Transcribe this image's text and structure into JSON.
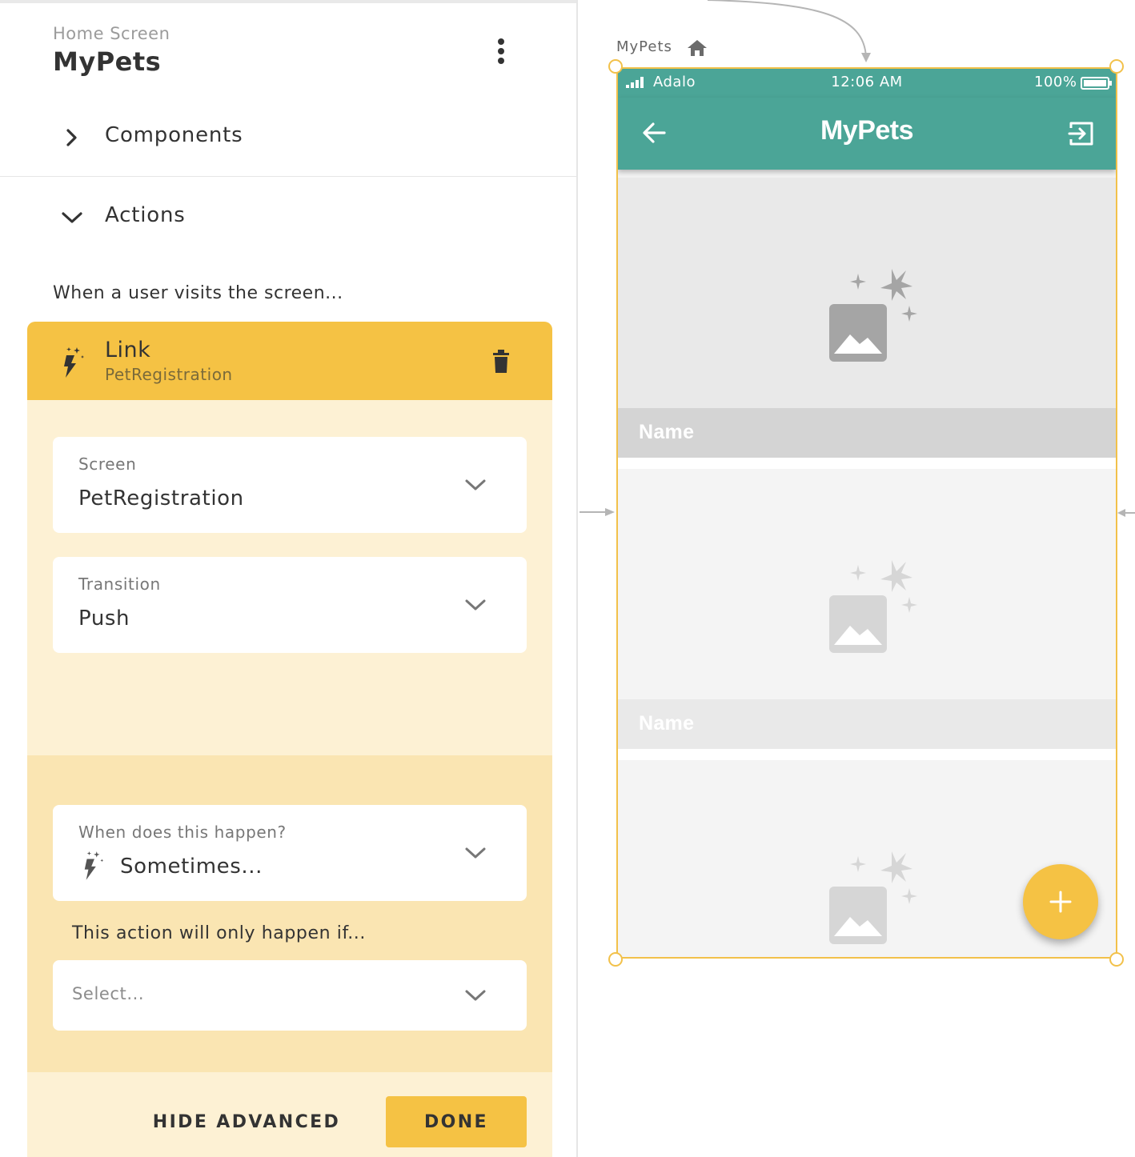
{
  "panel": {
    "screen_subtitle": "Home Screen",
    "screen_title": "MyPets",
    "sections": {
      "components": "Components",
      "actions": "Actions"
    },
    "trigger_text": "When a user visits the screen..."
  },
  "action": {
    "type": "Link",
    "target": "PetRegistration",
    "fields": {
      "screen": {
        "label": "Screen",
        "value": "PetRegistration"
      },
      "transition": {
        "label": "Transition",
        "value": "Push"
      }
    },
    "advanced": {
      "when": {
        "label": "When does this happen?",
        "value": "Sometimes..."
      },
      "condition_text": "This action will only happen if...",
      "condition_placeholder": "Select..."
    },
    "hide_advanced_label": "HIDE ADVANCED",
    "done_label": "DONE"
  },
  "canvas": {
    "screen_name": "MyPets",
    "status_bar": {
      "carrier": "Adalo",
      "time": "12:06 AM",
      "battery": "100%"
    },
    "app_title": "MyPets",
    "list_items": [
      {
        "name": "Name"
      },
      {
        "name": "Name"
      },
      {
        "name": ""
      }
    ]
  },
  "colors": {
    "accent": "#f5c244",
    "card_background": "#fdf1d4",
    "advanced_background": "#fae5b2",
    "app_bar": "#4ba597",
    "selection_border": "#f2c14a"
  },
  "icons": {
    "menu": "kebab-icon",
    "collapsed": "chevron-right-icon",
    "expanded": "chevron-down-icon",
    "action": "magic-bolt-icon",
    "delete": "trash-icon",
    "home": "home-icon",
    "back": "arrow-left-icon",
    "logout": "logout-icon",
    "placeholder": "image-placeholder-icon",
    "add": "plus-icon"
  }
}
